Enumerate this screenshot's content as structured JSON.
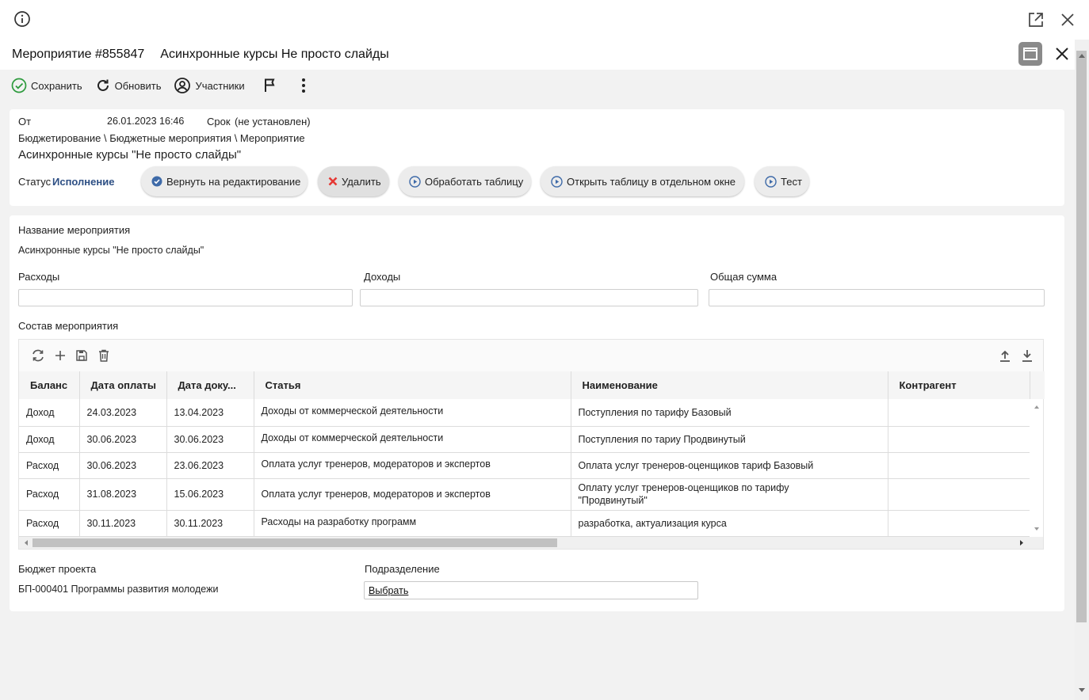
{
  "window": {
    "title_number": "Мероприятие #855847",
    "title_name": "Асинхронные курсы Не просто слайды"
  },
  "toolbar": {
    "save_label": "Сохранить",
    "refresh_label": "Обновить",
    "participants_label": "Участники"
  },
  "header": {
    "from_label": "От",
    "from_value": "26.01.2023 16:46",
    "deadline_label": "Срок",
    "deadline_value": "(не установлен)",
    "breadcrumb": "Бюджетирование \\ Бюджетные мероприятия \\ Мероприятие",
    "event_title": "Асинхронные курсы \"Не просто слайды\"",
    "status_label": "Статус",
    "status_value": "Исполнение"
  },
  "actions": {
    "return_edit": "Вернуть на редактирование",
    "delete": "Удалить",
    "process_table": "Обработать таблицу",
    "open_table": "Открыть таблицу в отдельном окне",
    "test": "Тест"
  },
  "form": {
    "name_label": "Название мероприятия",
    "name_value": "Асинхронные курсы \"Не просто слайды\"",
    "expenses_label": "Расходы",
    "income_label": "Доходы",
    "total_label": "Общая сумма",
    "composition_label": "Состав мероприятия",
    "budget_label": "Бюджет проекта",
    "budget_value": "БП-000401 Программы развития молодежи",
    "division_label": "Подразделение",
    "division_value": "Выбрать"
  },
  "table": {
    "columns": [
      "Баланс",
      "Дата оплаты",
      "Дата доку...",
      "Статья",
      "Наименование",
      "Контрагент"
    ],
    "rows": [
      [
        "Доход",
        "24.03.2023",
        "13.04.2023",
        "Доходы от коммерческой деятельности",
        "Поступления по тарифу Базовый",
        ""
      ],
      [
        "Доход",
        "30.06.2023",
        "30.06.2023",
        "Доходы от коммерческой деятельности",
        "Поступления по тариу Продвинутый",
        ""
      ],
      [
        "Расход",
        "30.06.2023",
        "23.06.2023",
        "Оплата услуг тренеров, модераторов и экспертов",
        "Оплата услуг тренеров-оценщиков тариф Базовый",
        ""
      ],
      [
        "Расход",
        "31.08.2023",
        "15.06.2023",
        "Оплата услуг тренеров, модераторов и экспертов",
        "Оплату услуг тренеров-оценщиков по тарифу \"Продвинутый\"",
        ""
      ],
      [
        "Расход",
        "30.11.2023",
        "30.11.2023",
        "Расходы на разработку программ",
        "разработка, актуализация курса",
        ""
      ]
    ]
  },
  "colors": {
    "accent": "#3e6aa8",
    "success": "#2e9b3e",
    "danger": "#e53935"
  }
}
